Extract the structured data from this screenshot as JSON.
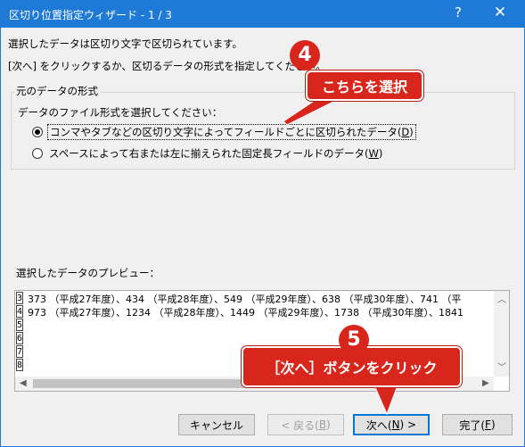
{
  "titlebar": {
    "title": "区切り位置指定ウィザード - 1 / 3",
    "help_glyph": "?",
    "close_glyph": "✕"
  },
  "intro": {
    "line1": "選択したデータは区切り文字で区切られています。",
    "line2": "[次へ] をクリックするか、区切るデータの形式を指定してください。"
  },
  "group": {
    "legend": "元のデータの形式",
    "prompt": "データのファイル形式を選択してください：",
    "options": [
      {
        "label_main": "コンマやタブなどの区切り文字によってフィールドごとに区切られたデータ(",
        "accel": "D",
        "label_end": ")",
        "selected": true
      },
      {
        "label_main": "スペースによって右または左に揃えられた固定長フィールドのデータ(",
        "accel": "W",
        "label_end": ")",
        "selected": false
      }
    ]
  },
  "preview": {
    "label": "選択したデータのプレビュー：",
    "row_numbers": [
      "3",
      "4",
      "5",
      "6",
      "7",
      "8"
    ],
    "lines": [
      "373 （平成27年度）、434 （平成28年度）、549 （平成29年度）、638 （平成30年度）、741 （平",
      "973 （平成27年度）、1234 （平成28年度）、1449 （平成29年度）、1738 （平成30年度）、1841"
    ]
  },
  "buttons": {
    "cancel": "キャンセル",
    "back_main": "< 戻る(",
    "back_accel": "B",
    "back_end": ")",
    "next_main": "次へ(",
    "next_accel": "N",
    "next_end": ") >",
    "finish_main": "完了(",
    "finish_accel": "F",
    "finish_end": ")"
  },
  "annotations": {
    "step4_number": "4",
    "step4_text": "こちらを選択",
    "step5_number": "5",
    "step5_text": "［次へ］ボタンをクリック",
    "color": "#d9261c"
  },
  "colors": {
    "titlebar": "#1e7ad6",
    "dialog_bg": "#f0f0f0",
    "default_button_border": "#0078d7"
  }
}
